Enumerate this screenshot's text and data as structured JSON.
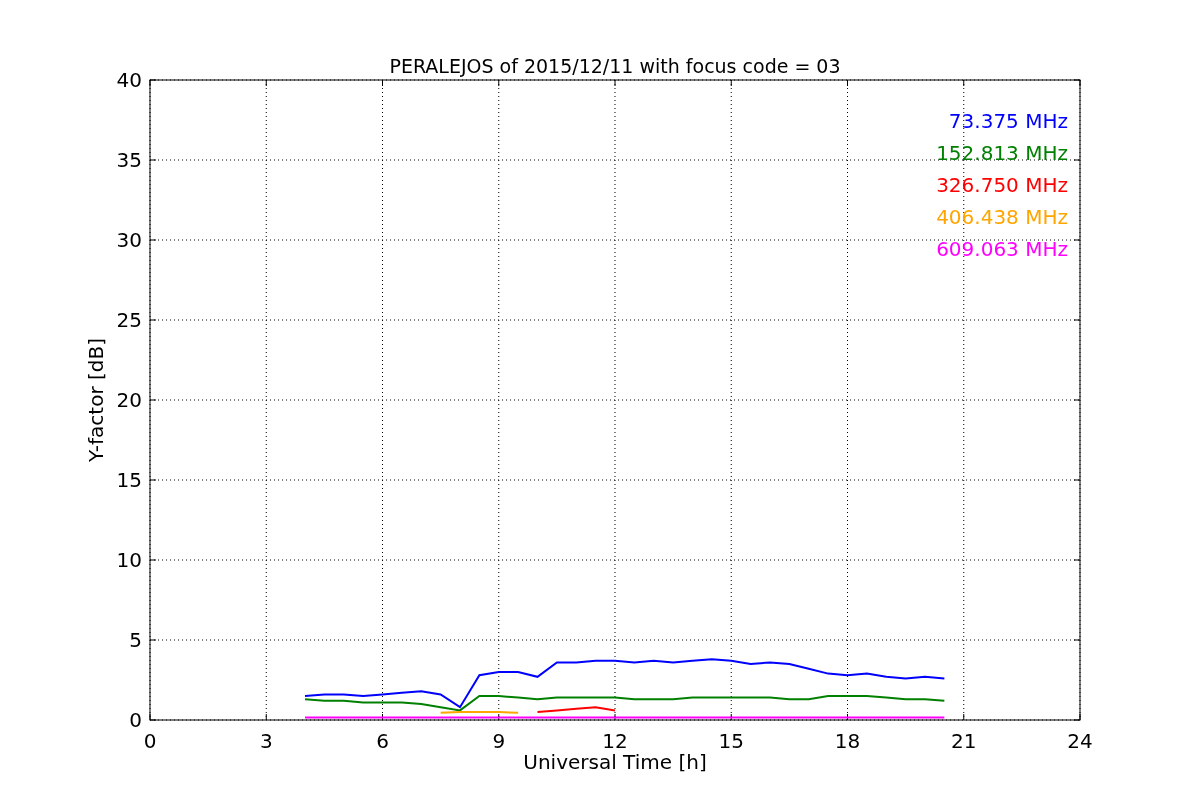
{
  "chart_data": {
    "type": "line",
    "title": "PERALEJOS of 2015/12/11 with focus code = 03",
    "xlabel": "Universal Time [h]",
    "ylabel": "Y-factor [dB]",
    "x": [
      4,
      4.5,
      5,
      5.5,
      6,
      6.5,
      7,
      7.5,
      8,
      8.5,
      9,
      9.5,
      10,
      10.5,
      11,
      11.5,
      12,
      12.5,
      13,
      13.5,
      14,
      14.5,
      15,
      15.5,
      16,
      16.5,
      17,
      17.5,
      18,
      18.5,
      19,
      19.5,
      20,
      20.5
    ],
    "series": [
      {
        "name": "73.375 MHz",
        "color": "#0000ff",
        "values": [
          1.5,
          1.6,
          1.6,
          1.5,
          1.6,
          1.7,
          1.8,
          1.6,
          0.8,
          2.8,
          3.0,
          3.0,
          2.7,
          3.6,
          3.6,
          3.7,
          3.7,
          3.6,
          3.7,
          3.6,
          3.7,
          3.8,
          3.7,
          3.5,
          3.6,
          3.5,
          3.2,
          2.9,
          2.8,
          2.9,
          2.7,
          2.6,
          2.7,
          2.6
        ]
      },
      {
        "name": "152.813 MHz",
        "color": "#008000",
        "values": [
          1.3,
          1.2,
          1.2,
          1.1,
          1.1,
          1.1,
          1.0,
          0.8,
          0.6,
          1.5,
          1.5,
          1.4,
          1.3,
          1.4,
          1.4,
          1.4,
          1.4,
          1.3,
          1.3,
          1.3,
          1.4,
          1.4,
          1.4,
          1.4,
          1.4,
          1.3,
          1.3,
          1.5,
          1.5,
          1.5,
          1.4,
          1.3,
          1.3,
          1.2
        ]
      },
      {
        "name": "326.750 MHz",
        "color": "#ff0000",
        "values": [
          null,
          null,
          null,
          null,
          null,
          null,
          null,
          null,
          null,
          null,
          null,
          null,
          0.5,
          0.6,
          0.7,
          0.8,
          0.6,
          null,
          null,
          null,
          null,
          null,
          null,
          null,
          null,
          null,
          null,
          null,
          null,
          null,
          null,
          null,
          null,
          null
        ]
      },
      {
        "name": "406.438 MHz",
        "color": "#ffa500",
        "values": [
          null,
          null,
          null,
          null,
          null,
          null,
          null,
          0.45,
          0.5,
          0.5,
          0.5,
          0.45,
          null,
          null,
          null,
          null,
          null,
          null,
          null,
          null,
          null,
          null,
          null,
          null,
          null,
          null,
          null,
          null,
          null,
          null,
          null,
          null,
          null,
          null
        ]
      },
      {
        "name": "609.063 MHz",
        "color": "#ff00ff",
        "values": [
          0.15,
          0.15,
          0.15,
          0.15,
          0.15,
          0.15,
          0.15,
          0.15,
          0.15,
          0.15,
          0.15,
          0.15,
          0.15,
          0.15,
          0.15,
          0.15,
          0.15,
          0.15,
          0.15,
          0.15,
          0.15,
          0.15,
          0.15,
          0.15,
          0.15,
          0.15,
          0.15,
          0.15,
          0.15,
          0.15,
          0.15,
          0.15,
          0.15,
          0.15
        ]
      }
    ],
    "grid": true,
    "xlim": [
      0,
      24
    ],
    "ylim": [
      0,
      40
    ],
    "xticks": [
      0,
      3,
      6,
      9,
      12,
      15,
      18,
      21,
      24
    ],
    "yticks": [
      0,
      5,
      10,
      15,
      20,
      25,
      30,
      35,
      40
    ]
  }
}
